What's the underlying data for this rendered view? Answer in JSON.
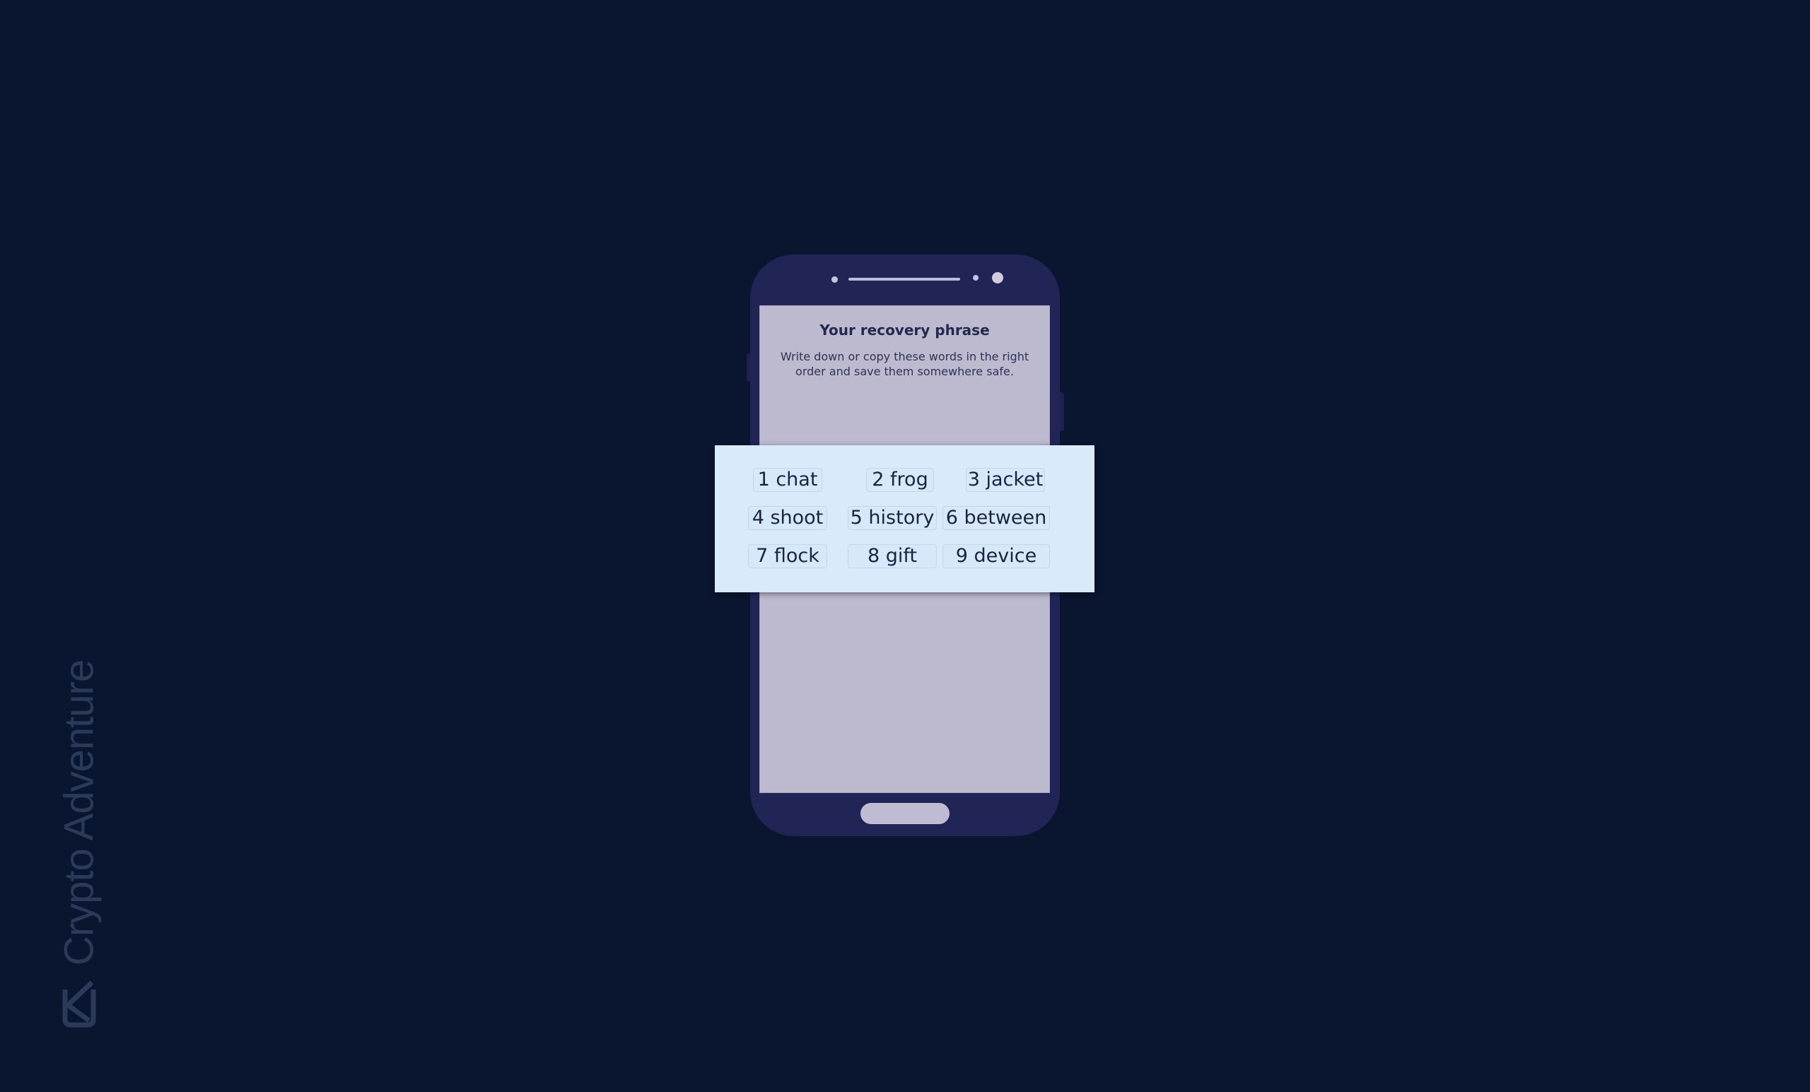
{
  "phone_screen": {
    "title": "Your recovery phrase",
    "subtitle_line1": "Write down or copy these words in the right",
    "subtitle_line2": "order and save them somewhere safe."
  },
  "recovery_phrase": {
    "words": [
      {
        "index": "1",
        "word": "chat",
        "label": "1 chat"
      },
      {
        "index": "2",
        "word": "frog",
        "label": "2 frog"
      },
      {
        "index": "3",
        "word": "jacket",
        "label": "3 jacket"
      },
      {
        "index": "4",
        "word": "shoot",
        "label": "4 shoot"
      },
      {
        "index": "5",
        "word": "history",
        "label": "5 history"
      },
      {
        "index": "6",
        "word": "between",
        "label": "6 between"
      },
      {
        "index": "7",
        "word": "flock",
        "label": "7 flock"
      },
      {
        "index": "8",
        "word": "gift",
        "label": "8 gift"
      },
      {
        "index": "9",
        "word": "device",
        "label": "9 device"
      }
    ]
  },
  "watermark": {
    "text": "Crypto Adventure",
    "logo_icon": "crypto-adventure-logo"
  },
  "colors": {
    "background": "#0a1630",
    "phone_body": "#212556",
    "screen": "#bdb9cf",
    "card": "#d9ebfb",
    "text_dark": "#1c2340",
    "watermark": "#2c3a5a"
  }
}
